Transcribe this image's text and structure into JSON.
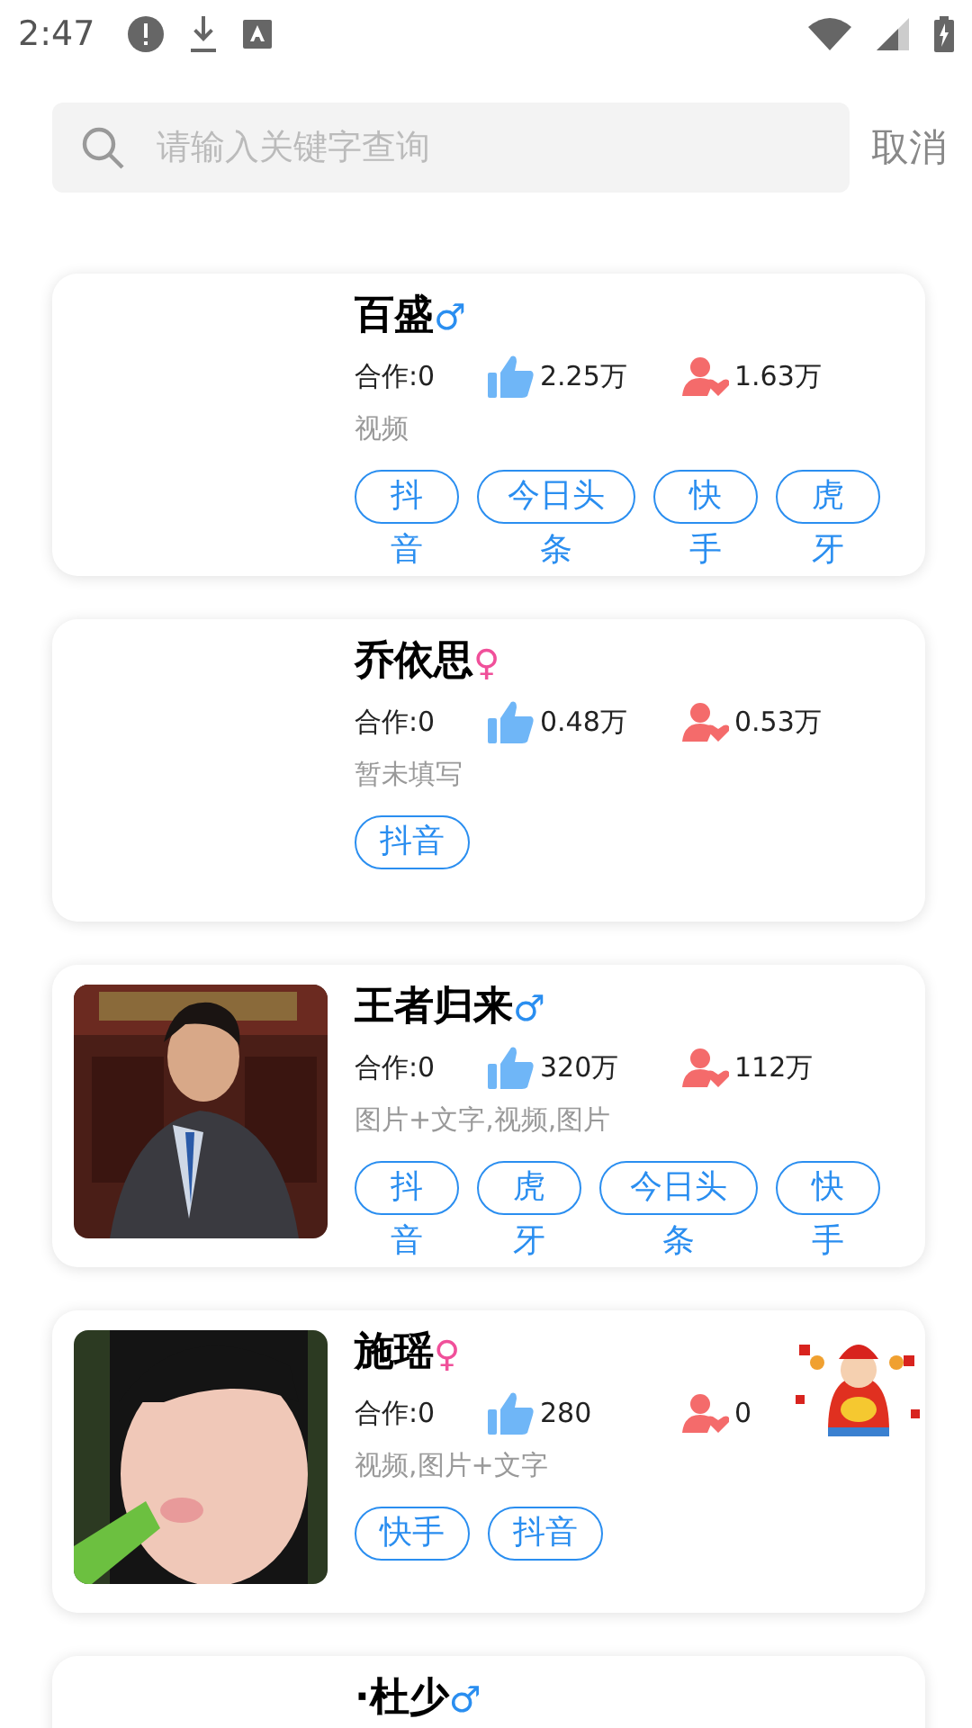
{
  "status_bar": {
    "time": "2:47"
  },
  "search": {
    "placeholder": "请输入关键字查询",
    "cancel": "取消"
  },
  "users": [
    {
      "name": "百盛",
      "gender": {
        "symbol": "♂",
        "color": "#2a8ef0"
      },
      "coop": "合作:0",
      "likes": "2.25万",
      "fans": "1.63万",
      "content": "视频",
      "tags": [
        "抖音",
        "今日头条",
        "快手",
        "虎牙"
      ]
    },
    {
      "name": "乔依思",
      "gender": {
        "symbol": "♀",
        "color": "#f0509a"
      },
      "coop": "合作:0",
      "likes": "0.48万",
      "fans": "0.53万",
      "content": "暂未填写",
      "tags": [
        "抖音"
      ]
    },
    {
      "name": "王者归来",
      "gender": {
        "symbol": "♂",
        "color": "#2a8ef0"
      },
      "avatar": {
        "kind": "picture"
      },
      "coop": "合作:0",
      "likes": "320万",
      "fans": "112万",
      "content": "图片+文字,视频,图片",
      "tags": [
        "抖音",
        "虎牙",
        "今日头条",
        "快手"
      ]
    },
    {
      "name": "施瑶",
      "gender": {
        "symbol": "♀",
        "color": "#f0509a"
      },
      "avatar": {
        "kind": "picture"
      },
      "sticker": true,
      "coop": "合作:0",
      "likes": "280",
      "fans": "0",
      "content": "视频,图片+文字",
      "tags": [
        "快手",
        "抖音"
      ]
    },
    {
      "name": "·杜少",
      "gender": {
        "symbol": "♂",
        "color": "#2a8ef0"
      }
    }
  ]
}
